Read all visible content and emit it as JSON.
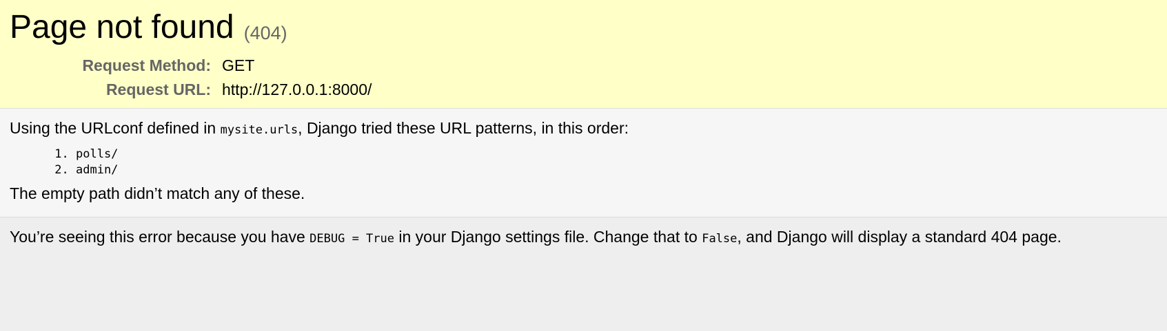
{
  "summary": {
    "title": "Page not found",
    "status_code": "(404)",
    "request_method_label": "Request Method:",
    "request_method_value": "GET",
    "request_url_label": "Request URL:",
    "request_url_value": "http://127.0.0.1:8000/"
  },
  "info": {
    "intro_before": "Using the URLconf defined in ",
    "urlconf": "mysite.urls",
    "intro_after": ", Django tried these URL patterns, in this order:",
    "patterns": [
      "polls/",
      "admin/"
    ],
    "no_match": "The empty path didn’t match any of these."
  },
  "explanation": {
    "part1": "You’re seeing this error because you have ",
    "debug_setting": "DEBUG = True",
    "part2": " in your Django settings file. Change that to ",
    "false_value": "False",
    "part3": ", and Django will display a standard 404 page."
  },
  "colors": {
    "summary_bg": "#ffffc8",
    "info_bg": "#f6f6f6",
    "explanation_bg": "#eeeeee",
    "label_gray": "#666666"
  }
}
